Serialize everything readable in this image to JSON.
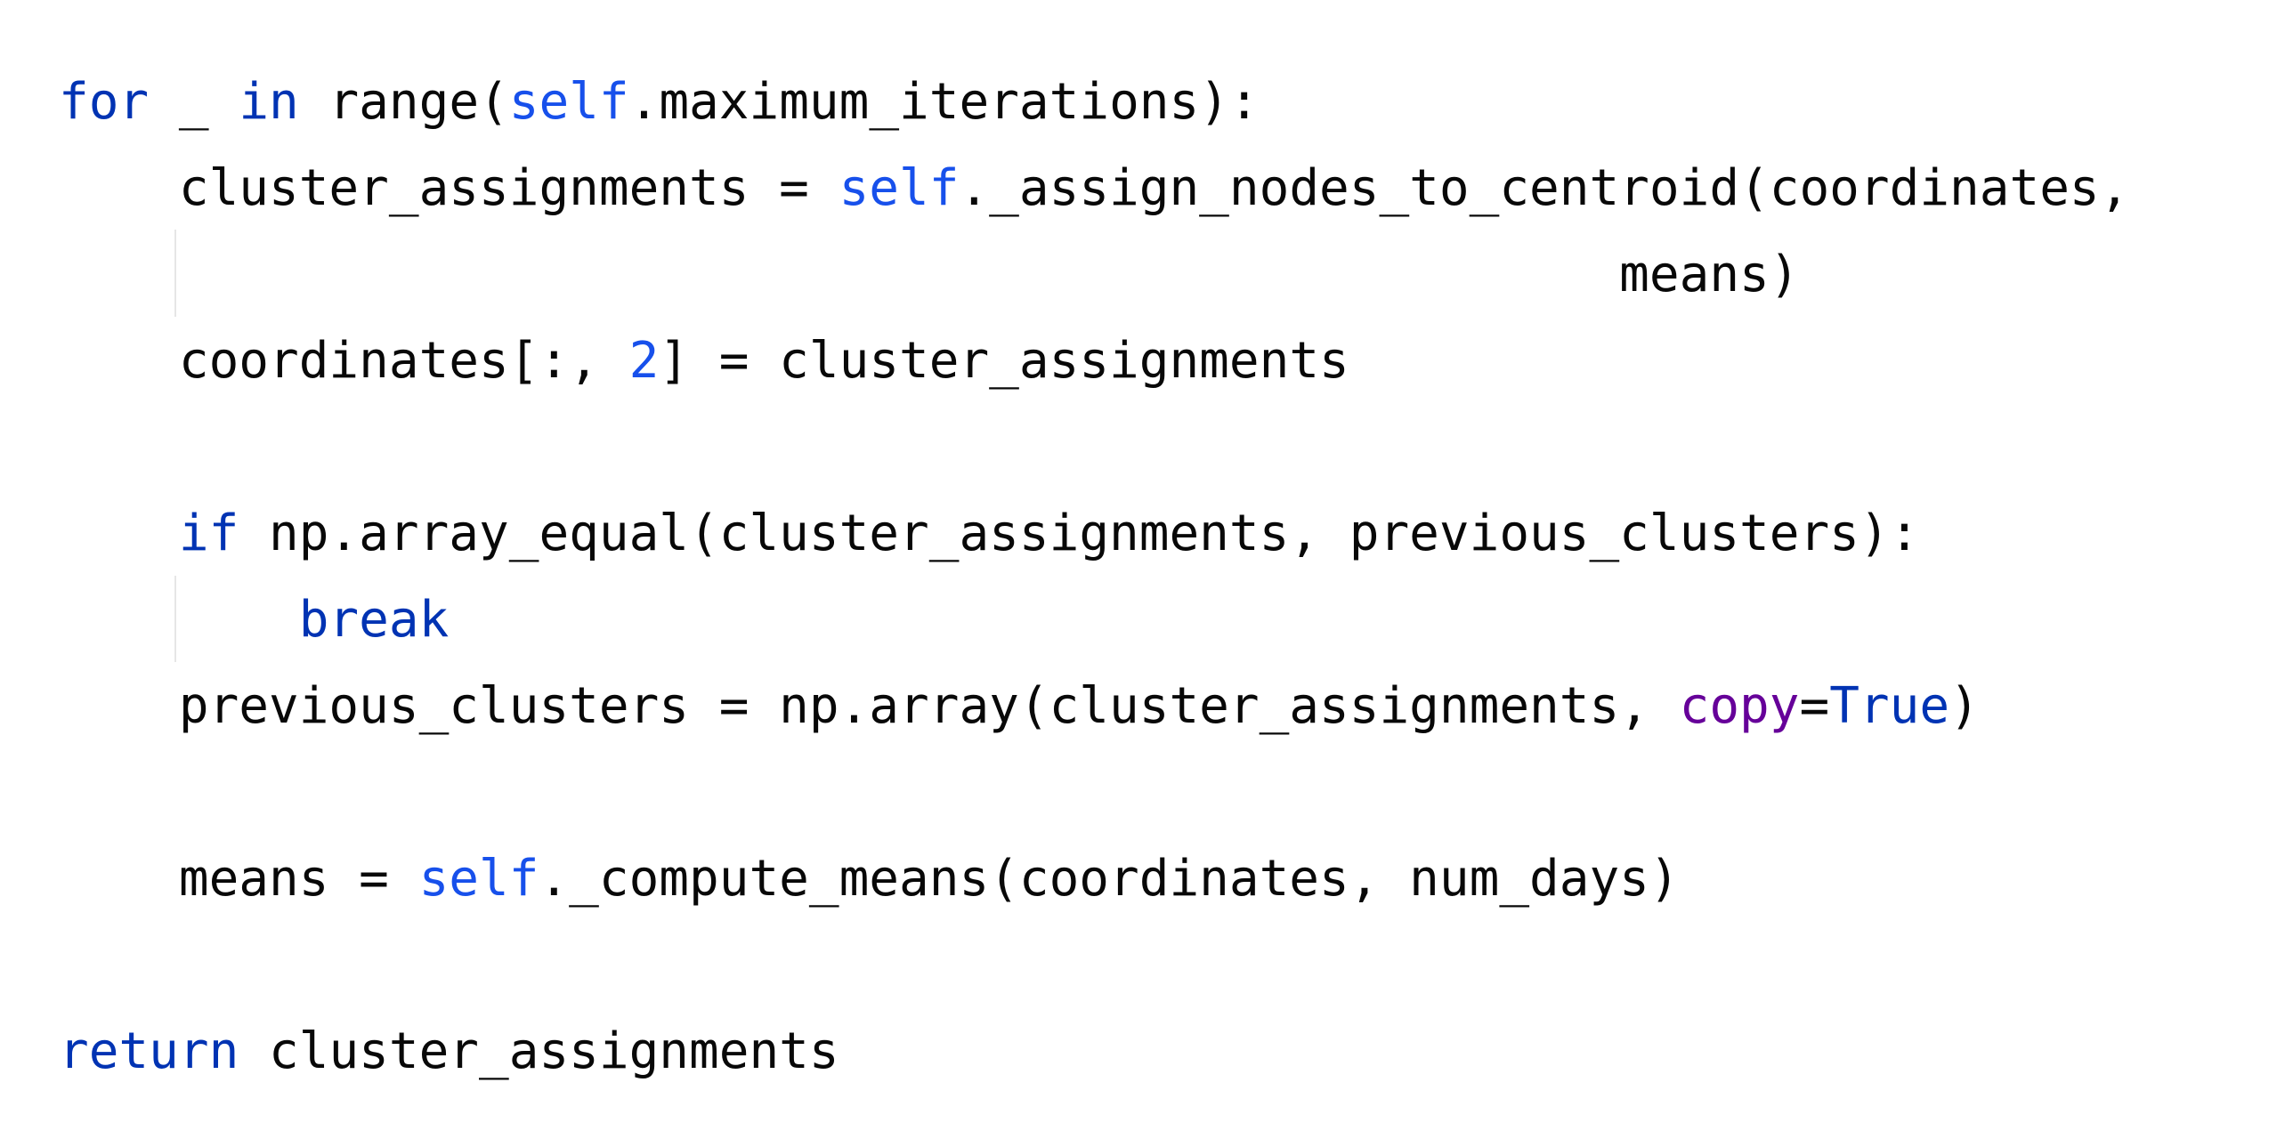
{
  "editor": {
    "lines": [
      {
        "tokens": [
          {
            "t": "kw",
            "v": "for"
          },
          {
            "t": "plain",
            "v": " _ "
          },
          {
            "t": "kw",
            "v": "in"
          },
          {
            "t": "plain",
            "v": " range("
          },
          {
            "t": "self",
            "v": "self"
          },
          {
            "t": "plain",
            "v": ".maximum_iterations):"
          }
        ]
      },
      {
        "tokens": [
          {
            "t": "plain",
            "v": "    cluster_assignments = "
          },
          {
            "t": "self",
            "v": "self"
          },
          {
            "t": "plain",
            "v": "._assign_nodes_to_centroid(coordinates,"
          }
        ]
      },
      {
        "tokens": [
          {
            "t": "plain",
            "v": "                                                    means)"
          }
        ]
      },
      {
        "tokens": [
          {
            "t": "plain",
            "v": "    coordinates[:, "
          },
          {
            "t": "num",
            "v": "2"
          },
          {
            "t": "plain",
            "v": "] = cluster_assignments"
          }
        ]
      },
      {
        "tokens": []
      },
      {
        "tokens": [
          {
            "t": "plain",
            "v": "    "
          },
          {
            "t": "kw",
            "v": "if"
          },
          {
            "t": "plain",
            "v": " np.array_equal(cluster_assignments, previous_clusters):"
          }
        ]
      },
      {
        "tokens": [
          {
            "t": "plain",
            "v": "        "
          },
          {
            "t": "kw",
            "v": "break"
          }
        ]
      },
      {
        "tokens": [
          {
            "t": "plain",
            "v": "    previous_clusters = np.array(cluster_assignments, "
          },
          {
            "t": "param",
            "v": "copy"
          },
          {
            "t": "plain",
            "v": "="
          },
          {
            "t": "kw",
            "v": "True"
          },
          {
            "t": "plain",
            "v": ")"
          }
        ]
      },
      {
        "tokens": []
      },
      {
        "tokens": [
          {
            "t": "plain",
            "v": "    means = "
          },
          {
            "t": "self",
            "v": "self"
          },
          {
            "t": "plain",
            "v": "._compute_means(coordinates, num_days)"
          }
        ]
      },
      {
        "tokens": []
      },
      {
        "tokens": [
          {
            "t": "kw",
            "v": "return"
          },
          {
            "t": "plain",
            "v": " cluster_assignments"
          }
        ]
      }
    ],
    "colors": {
      "keyword": "#0033b3",
      "self": "#1750eb",
      "number": "#1750eb",
      "named_argument": "#660099",
      "text": "#080808",
      "indent_guide": "#e6e6e6",
      "background": "#ffffff"
    }
  }
}
